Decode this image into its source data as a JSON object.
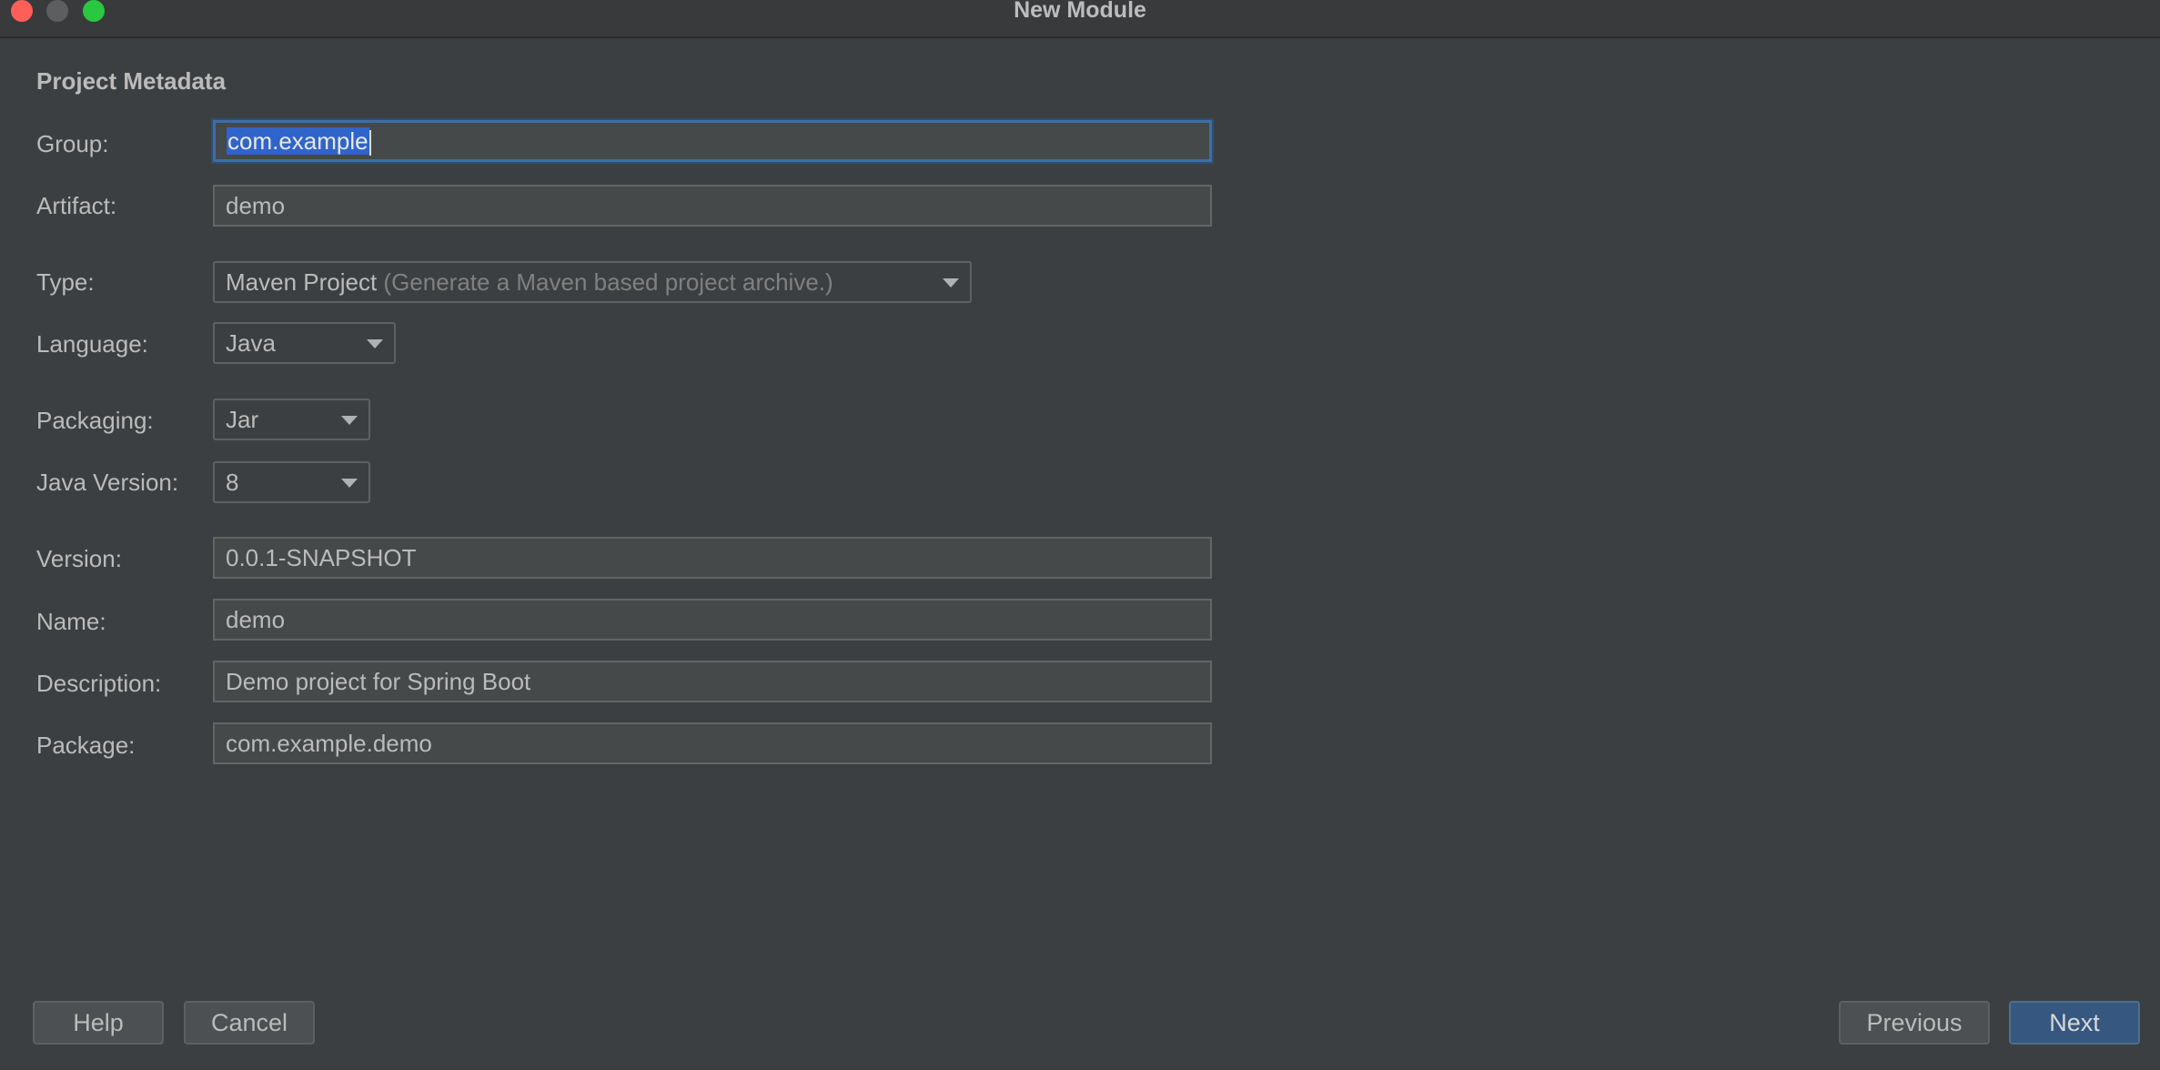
{
  "window": {
    "title": "New Module"
  },
  "section": {
    "title": "Project Metadata"
  },
  "form": {
    "group": {
      "label": "Group:",
      "value": "com.example"
    },
    "artifact": {
      "label": "Artifact:",
      "value": "demo"
    },
    "type": {
      "label": "Type:",
      "value": "Maven Project",
      "hint": "(Generate a Maven based project archive.)"
    },
    "language": {
      "label": "Language:",
      "value": "Java"
    },
    "packaging": {
      "label": "Packaging:",
      "value": "Jar"
    },
    "java_version": {
      "label": "Java Version:",
      "value": "8"
    },
    "version": {
      "label": "Version:",
      "value": "0.0.1-SNAPSHOT"
    },
    "name": {
      "label": "Name:",
      "value": "demo"
    },
    "description": {
      "label": "Description:",
      "value": "Demo project for Spring Boot"
    },
    "package": {
      "label": "Package:",
      "value": "com.example.demo"
    }
  },
  "buttons": {
    "help": "Help",
    "cancel": "Cancel",
    "previous": "Previous",
    "next": "Next"
  },
  "icons": {
    "close": "close-traffic-light",
    "minimize": "minimize-traffic-light",
    "maximize": "maximize-traffic-light",
    "dropdown": "chevron-down-icon"
  },
  "colors": {
    "background": "#3c3f41",
    "field_bg": "#45494a",
    "focus_border": "#3d6ea4",
    "selection": "#2f65ca",
    "primary_button": "#365880",
    "close": "#ff5f57",
    "maximize": "#28c840"
  }
}
